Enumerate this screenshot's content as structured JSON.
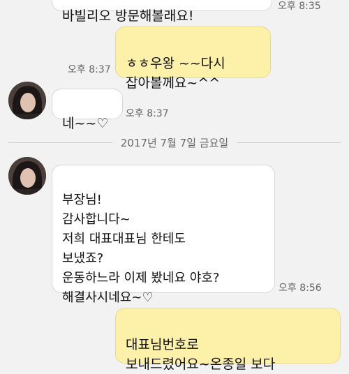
{
  "messages": {
    "m0": {
      "text": "바빌리오 방문해볼래요!",
      "time": "오후 8:35"
    },
    "m1": {
      "text": "ㅎㅎ우왕 ~~다시\n잡아볼께요~^^",
      "time": "오후 8:37"
    },
    "m2": {
      "text": "네~~♡",
      "time": "오후 8:37"
    },
    "m3": {
      "text": "부장님!\n감사합니다~\n저희 대표대표님 한테도\n보냈죠?\n운동하느라 이제 봤네요 야호?\n해결사시네요~♡",
      "time": "오후 8:56"
    },
    "m4": {
      "text": "대표님번호로\n보내드렸어요~온종일 보다"
    }
  },
  "date_separator": "2017년 7월 7일 금요일",
  "colors": {
    "incoming_bubble": "#ffffff",
    "outgoing_bubble": "#fdf0a8",
    "background": "#f2f2f2"
  }
}
